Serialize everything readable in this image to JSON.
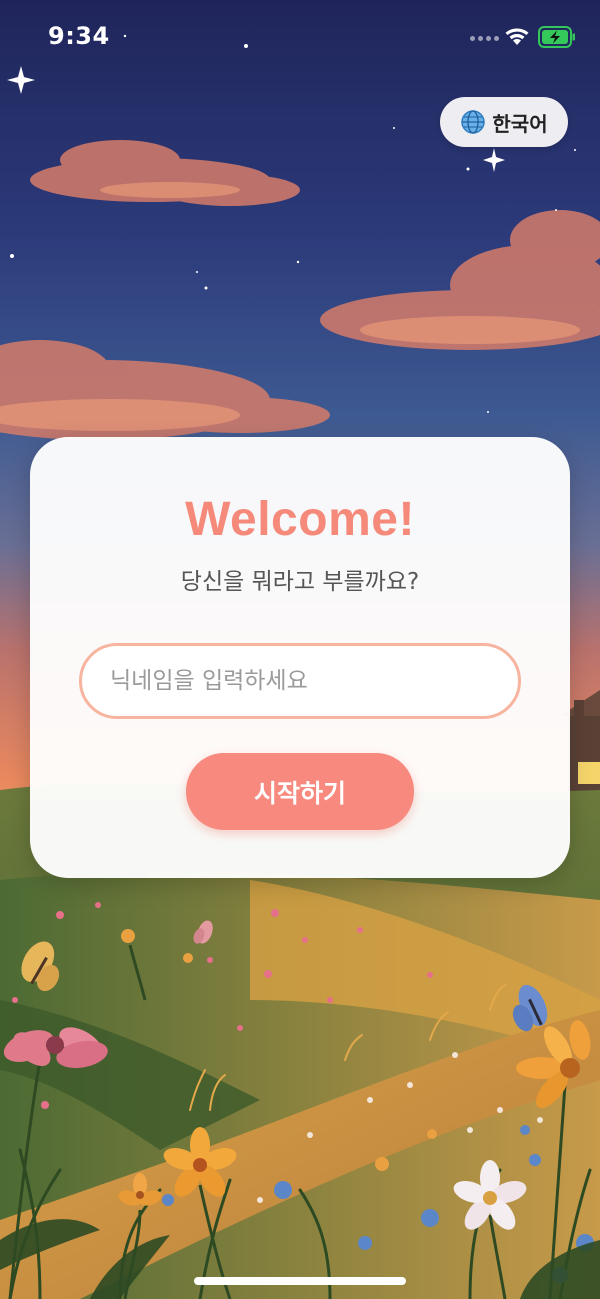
{
  "status_bar": {
    "time": "9:34"
  },
  "language_button": {
    "label": "한국어",
    "icon": "globe-icon"
  },
  "welcome": {
    "title": "Welcome!",
    "subtitle": "당신을 뭐라고 부를까요?",
    "nickname_placeholder": "닉네임을 입력하세요",
    "nickname_value": "",
    "start_label": "시작하기"
  },
  "colors": {
    "accent": "#f7897e",
    "title": "#f5897a",
    "input_border": "#f7b49f",
    "sky_top": "#232a5c",
    "sky_bottom": "#e98a5e"
  }
}
